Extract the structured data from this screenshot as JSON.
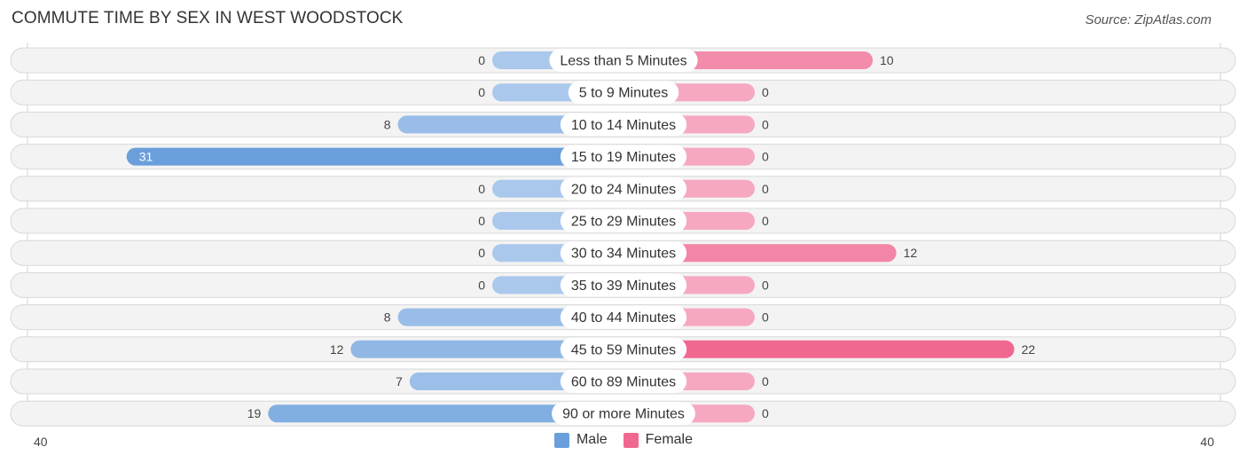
{
  "header": {
    "title": "COMMUTE TIME BY SEX IN WEST WOODSTOCK",
    "source": "Source: ZipAtlas.com"
  },
  "colors": {
    "male": "#6a9fdb",
    "male_light": "#a9c8ec",
    "female": "#f06890",
    "female_light": "#f6a8c0",
    "row_bg": "#f3f3f3"
  },
  "chart_data": {
    "type": "bar",
    "orientation": "horizontal-diverging",
    "title": "COMMUTE TIME BY SEX IN WEST WOODSTOCK",
    "categories": [
      "Less than 5 Minutes",
      "5 to 9 Minutes",
      "10 to 14 Minutes",
      "15 to 19 Minutes",
      "20 to 24 Minutes",
      "25 to 29 Minutes",
      "30 to 34 Minutes",
      "35 to 39 Minutes",
      "40 to 44 Minutes",
      "45 to 59 Minutes",
      "60 to 89 Minutes",
      "90 or more Minutes"
    ],
    "series": [
      {
        "name": "Male",
        "values": [
          0,
          0,
          8,
          31,
          0,
          0,
          0,
          0,
          8,
          12,
          7,
          19
        ]
      },
      {
        "name": "Female",
        "values": [
          10,
          0,
          0,
          0,
          0,
          0,
          12,
          0,
          0,
          22,
          0,
          0
        ]
      }
    ],
    "axis": {
      "left_label": "40",
      "right_label": "40",
      "range": [
        -40,
        40
      ]
    },
    "legend": {
      "entries": [
        "Male",
        "Female"
      ],
      "position": "bottom-center"
    }
  }
}
